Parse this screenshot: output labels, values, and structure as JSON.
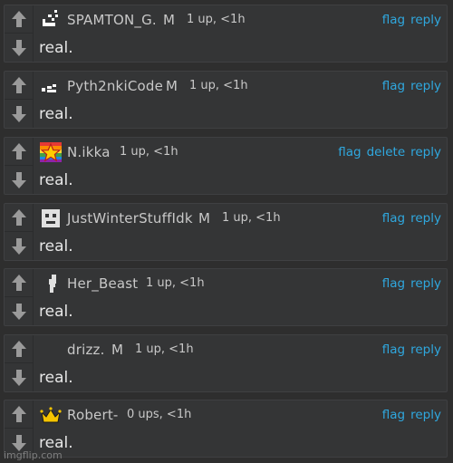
{
  "comments": [
    {
      "username": "SPAMTON_G.",
      "badge": "M",
      "meta": "1 up, <1h",
      "text": "real.",
      "avatar_icon": "spamton-pixel-icon",
      "actions": [
        "flag",
        "reply"
      ]
    },
    {
      "username": "Pyth2nkiCode",
      "badge": "M",
      "meta": "1 up, <1h",
      "text": "real.",
      "avatar_icon": "pixel-snake-icon",
      "actions": [
        "flag",
        "reply"
      ]
    },
    {
      "username": "N.ikka",
      "badge": "",
      "meta": "1 up, <1h",
      "text": "real.",
      "avatar_icon": "rainbow-star-icon",
      "actions": [
        "flag",
        "delete",
        "reply"
      ]
    },
    {
      "username": "JustWinterStuffIdk",
      "badge": "M",
      "meta": "1 up, <1h",
      "text": "real.",
      "avatar_icon": "pixel-face-icon",
      "actions": [
        "flag",
        "reply"
      ]
    },
    {
      "username": "Her_Beast",
      "badge": "",
      "meta": "1 up, <1h",
      "text": "real.",
      "avatar_icon": "pixel-figure-icon",
      "actions": [
        "flag",
        "reply"
      ]
    },
    {
      "username": "drizz.",
      "badge": "M",
      "meta": "1 up, <1h",
      "text": "real.",
      "avatar_icon": "",
      "actions": [
        "flag",
        "reply"
      ]
    },
    {
      "username": "Robert-",
      "badge": "",
      "meta": "0 ups, <1h",
      "text": "real.",
      "avatar_icon": "crown-icon",
      "actions": [
        "flag",
        "reply"
      ]
    }
  ],
  "watermark": "imgflip.com",
  "colors": {
    "background": "#2e2e2e",
    "card": "#343536",
    "link": "#2fa8df",
    "text": "#e6e6e6",
    "arrow": "#9a9a9a"
  }
}
